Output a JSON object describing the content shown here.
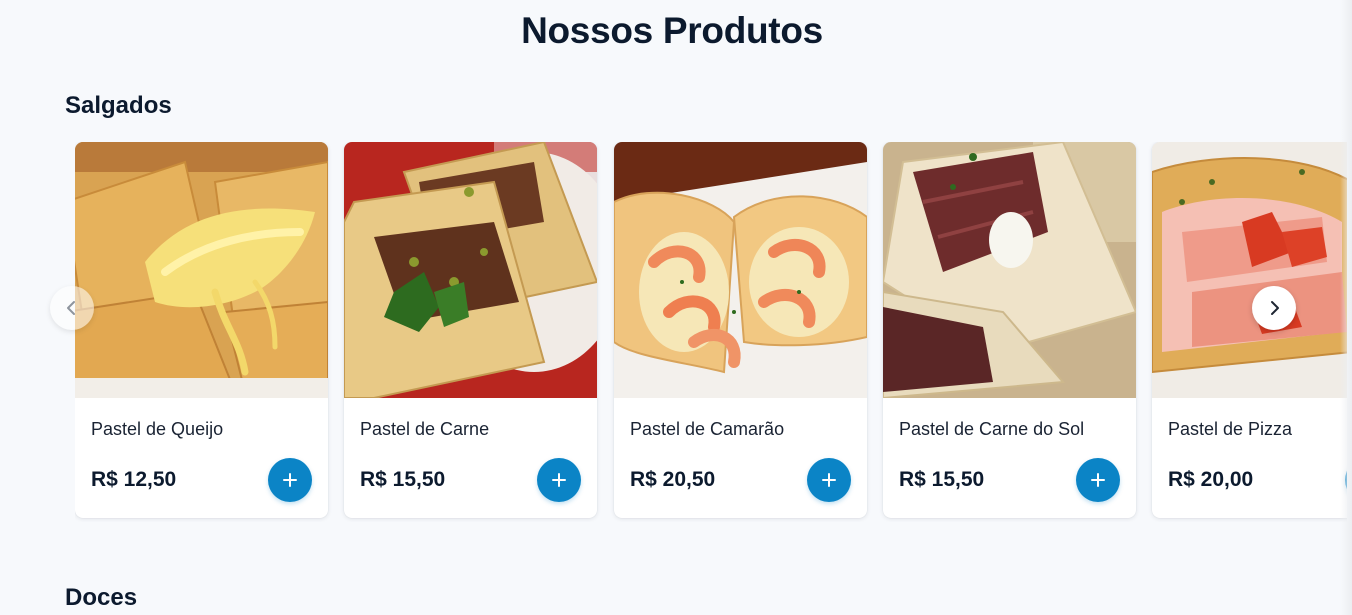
{
  "page": {
    "title": "Nossos Produtos"
  },
  "sections": [
    {
      "title": "Salgados",
      "products": [
        {
          "name": "Pastel de Queijo",
          "price": "R$ 12,50",
          "image_icon": "cheese-pastel-photo"
        },
        {
          "name": "Pastel de Carne",
          "price": "R$ 15,50",
          "image_icon": "beef-pastel-photo"
        },
        {
          "name": "Pastel de Camarão",
          "price": "R$ 20,50",
          "image_icon": "shrimp-pastel-photo"
        },
        {
          "name": "Pastel de Carne do Sol",
          "price": "R$ 15,50",
          "image_icon": "dried-beef-pastel-photo"
        },
        {
          "name": "Pastel de Pizza",
          "price": "R$ 20,00",
          "image_icon": "pizza-pastel-photo"
        }
      ]
    },
    {
      "title": "Doces"
    }
  ],
  "colors": {
    "background": "#f7f9fc",
    "heading": "#0c1a2e",
    "accent": "#0b84c6",
    "card": "#ffffff"
  },
  "icons": {
    "add": "plus-icon",
    "previous": "chevron-left-icon",
    "next": "chevron-right-icon"
  }
}
